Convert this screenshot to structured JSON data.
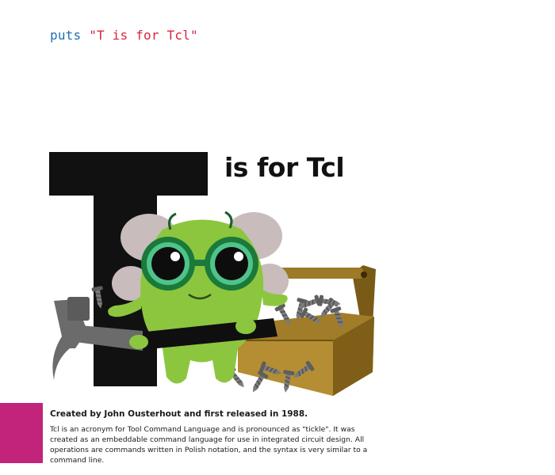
{
  "code": {
    "keyword": "puts",
    "string": "\"T is for Tcl\""
  },
  "heading": {
    "big_letter": "T",
    "text": "is for Tcl"
  },
  "caption": {
    "title": "Created by John Ousterhout and first released in 1988.",
    "body": "Tcl is an acronym for Tool Command Language and is pronounced as \"tickle\". It was created as an embeddable command language for use in integrated circuit design. All operations are commands written in Polish notation, and the syntax is very similar to a command line."
  },
  "colors": {
    "code_keyword": "#1f6fb2",
    "code_string": "#d7263d",
    "accent": "#c2237b",
    "letter": "#111111",
    "monster_green": "#8cc63f",
    "toolbox_brown": "#8b6a1e"
  },
  "icons": {
    "mascot": "green-monster-icon",
    "tool": "hammer-icon",
    "box": "toolbox-icon",
    "parts": "screw-icon"
  }
}
